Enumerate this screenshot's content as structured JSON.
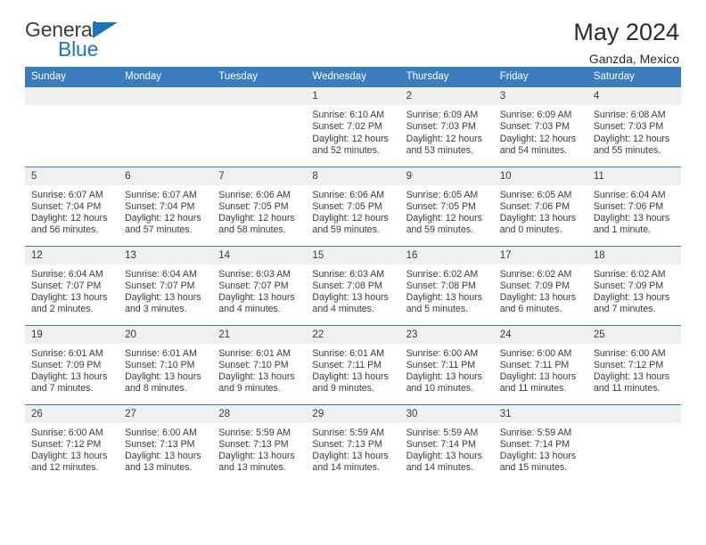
{
  "logo": {
    "word_top": "General",
    "word_bottom": "Blue",
    "triangle_icon": "blue-triangle-icon",
    "accent_color": "#1b75bb"
  },
  "header": {
    "title": "May 2024",
    "subtitle": "Ganzda, Mexico"
  },
  "theme": {
    "header_row_bg": "#3a7cbe",
    "daynum_bg": "#f0f0f0",
    "text_color": "#3a3a3a"
  },
  "weekday_headers": [
    "Sunday",
    "Monday",
    "Tuesday",
    "Wednesday",
    "Thursday",
    "Friday",
    "Saturday"
  ],
  "labels": {
    "sunrise": "Sunrise:",
    "sunset": "Sunset:",
    "daylight": "Daylight:"
  },
  "weeks": [
    [
      {
        "day": "",
        "empty": true
      },
      {
        "day": "",
        "empty": true
      },
      {
        "day": "",
        "empty": true
      },
      {
        "day": "1",
        "sunrise": "Sunrise: 6:10 AM",
        "sunset": "Sunset: 7:02 PM",
        "daylight": "Daylight: 12 hours and 52 minutes."
      },
      {
        "day": "2",
        "sunrise": "Sunrise: 6:09 AM",
        "sunset": "Sunset: 7:03 PM",
        "daylight": "Daylight: 12 hours and 53 minutes."
      },
      {
        "day": "3",
        "sunrise": "Sunrise: 6:09 AM",
        "sunset": "Sunset: 7:03 PM",
        "daylight": "Daylight: 12 hours and 54 minutes."
      },
      {
        "day": "4",
        "sunrise": "Sunrise: 6:08 AM",
        "sunset": "Sunset: 7:03 PM",
        "daylight": "Daylight: 12 hours and 55 minutes."
      }
    ],
    [
      {
        "day": "5",
        "sunrise": "Sunrise: 6:07 AM",
        "sunset": "Sunset: 7:04 PM",
        "daylight": "Daylight: 12 hours and 56 minutes."
      },
      {
        "day": "6",
        "sunrise": "Sunrise: 6:07 AM",
        "sunset": "Sunset: 7:04 PM",
        "daylight": "Daylight: 12 hours and 57 minutes."
      },
      {
        "day": "7",
        "sunrise": "Sunrise: 6:06 AM",
        "sunset": "Sunset: 7:05 PM",
        "daylight": "Daylight: 12 hours and 58 minutes."
      },
      {
        "day": "8",
        "sunrise": "Sunrise: 6:06 AM",
        "sunset": "Sunset: 7:05 PM",
        "daylight": "Daylight: 12 hours and 59 minutes."
      },
      {
        "day": "9",
        "sunrise": "Sunrise: 6:05 AM",
        "sunset": "Sunset: 7:05 PM",
        "daylight": "Daylight: 12 hours and 59 minutes."
      },
      {
        "day": "10",
        "sunrise": "Sunrise: 6:05 AM",
        "sunset": "Sunset: 7:06 PM",
        "daylight": "Daylight: 13 hours and 0 minutes."
      },
      {
        "day": "11",
        "sunrise": "Sunrise: 6:04 AM",
        "sunset": "Sunset: 7:06 PM",
        "daylight": "Daylight: 13 hours and 1 minute."
      }
    ],
    [
      {
        "day": "12",
        "sunrise": "Sunrise: 6:04 AM",
        "sunset": "Sunset: 7:07 PM",
        "daylight": "Daylight: 13 hours and 2 minutes."
      },
      {
        "day": "13",
        "sunrise": "Sunrise: 6:04 AM",
        "sunset": "Sunset: 7:07 PM",
        "daylight": "Daylight: 13 hours and 3 minutes."
      },
      {
        "day": "14",
        "sunrise": "Sunrise: 6:03 AM",
        "sunset": "Sunset: 7:07 PM",
        "daylight": "Daylight: 13 hours and 4 minutes."
      },
      {
        "day": "15",
        "sunrise": "Sunrise: 6:03 AM",
        "sunset": "Sunset: 7:08 PM",
        "daylight": "Daylight: 13 hours and 4 minutes."
      },
      {
        "day": "16",
        "sunrise": "Sunrise: 6:02 AM",
        "sunset": "Sunset: 7:08 PM",
        "daylight": "Daylight: 13 hours and 5 minutes."
      },
      {
        "day": "17",
        "sunrise": "Sunrise: 6:02 AM",
        "sunset": "Sunset: 7:09 PM",
        "daylight": "Daylight: 13 hours and 6 minutes."
      },
      {
        "day": "18",
        "sunrise": "Sunrise: 6:02 AM",
        "sunset": "Sunset: 7:09 PM",
        "daylight": "Daylight: 13 hours and 7 minutes."
      }
    ],
    [
      {
        "day": "19",
        "sunrise": "Sunrise: 6:01 AM",
        "sunset": "Sunset: 7:09 PM",
        "daylight": "Daylight: 13 hours and 7 minutes."
      },
      {
        "day": "20",
        "sunrise": "Sunrise: 6:01 AM",
        "sunset": "Sunset: 7:10 PM",
        "daylight": "Daylight: 13 hours and 8 minutes."
      },
      {
        "day": "21",
        "sunrise": "Sunrise: 6:01 AM",
        "sunset": "Sunset: 7:10 PM",
        "daylight": "Daylight: 13 hours and 9 minutes."
      },
      {
        "day": "22",
        "sunrise": "Sunrise: 6:01 AM",
        "sunset": "Sunset: 7:11 PM",
        "daylight": "Daylight: 13 hours and 9 minutes."
      },
      {
        "day": "23",
        "sunrise": "Sunrise: 6:00 AM",
        "sunset": "Sunset: 7:11 PM",
        "daylight": "Daylight: 13 hours and 10 minutes."
      },
      {
        "day": "24",
        "sunrise": "Sunrise: 6:00 AM",
        "sunset": "Sunset: 7:11 PM",
        "daylight": "Daylight: 13 hours and 11 minutes."
      },
      {
        "day": "25",
        "sunrise": "Sunrise: 6:00 AM",
        "sunset": "Sunset: 7:12 PM",
        "daylight": "Daylight: 13 hours and 11 minutes."
      }
    ],
    [
      {
        "day": "26",
        "sunrise": "Sunrise: 6:00 AM",
        "sunset": "Sunset: 7:12 PM",
        "daylight": "Daylight: 13 hours and 12 minutes."
      },
      {
        "day": "27",
        "sunrise": "Sunrise: 6:00 AM",
        "sunset": "Sunset: 7:13 PM",
        "daylight": "Daylight: 13 hours and 13 minutes."
      },
      {
        "day": "28",
        "sunrise": "Sunrise: 5:59 AM",
        "sunset": "Sunset: 7:13 PM",
        "daylight": "Daylight: 13 hours and 13 minutes."
      },
      {
        "day": "29",
        "sunrise": "Sunrise: 5:59 AM",
        "sunset": "Sunset: 7:13 PM",
        "daylight": "Daylight: 13 hours and 14 minutes."
      },
      {
        "day": "30",
        "sunrise": "Sunrise: 5:59 AM",
        "sunset": "Sunset: 7:14 PM",
        "daylight": "Daylight: 13 hours and 14 minutes."
      },
      {
        "day": "31",
        "sunrise": "Sunrise: 5:59 AM",
        "sunset": "Sunset: 7:14 PM",
        "daylight": "Daylight: 13 hours and 15 minutes."
      },
      {
        "day": "",
        "empty": true
      }
    ]
  ]
}
